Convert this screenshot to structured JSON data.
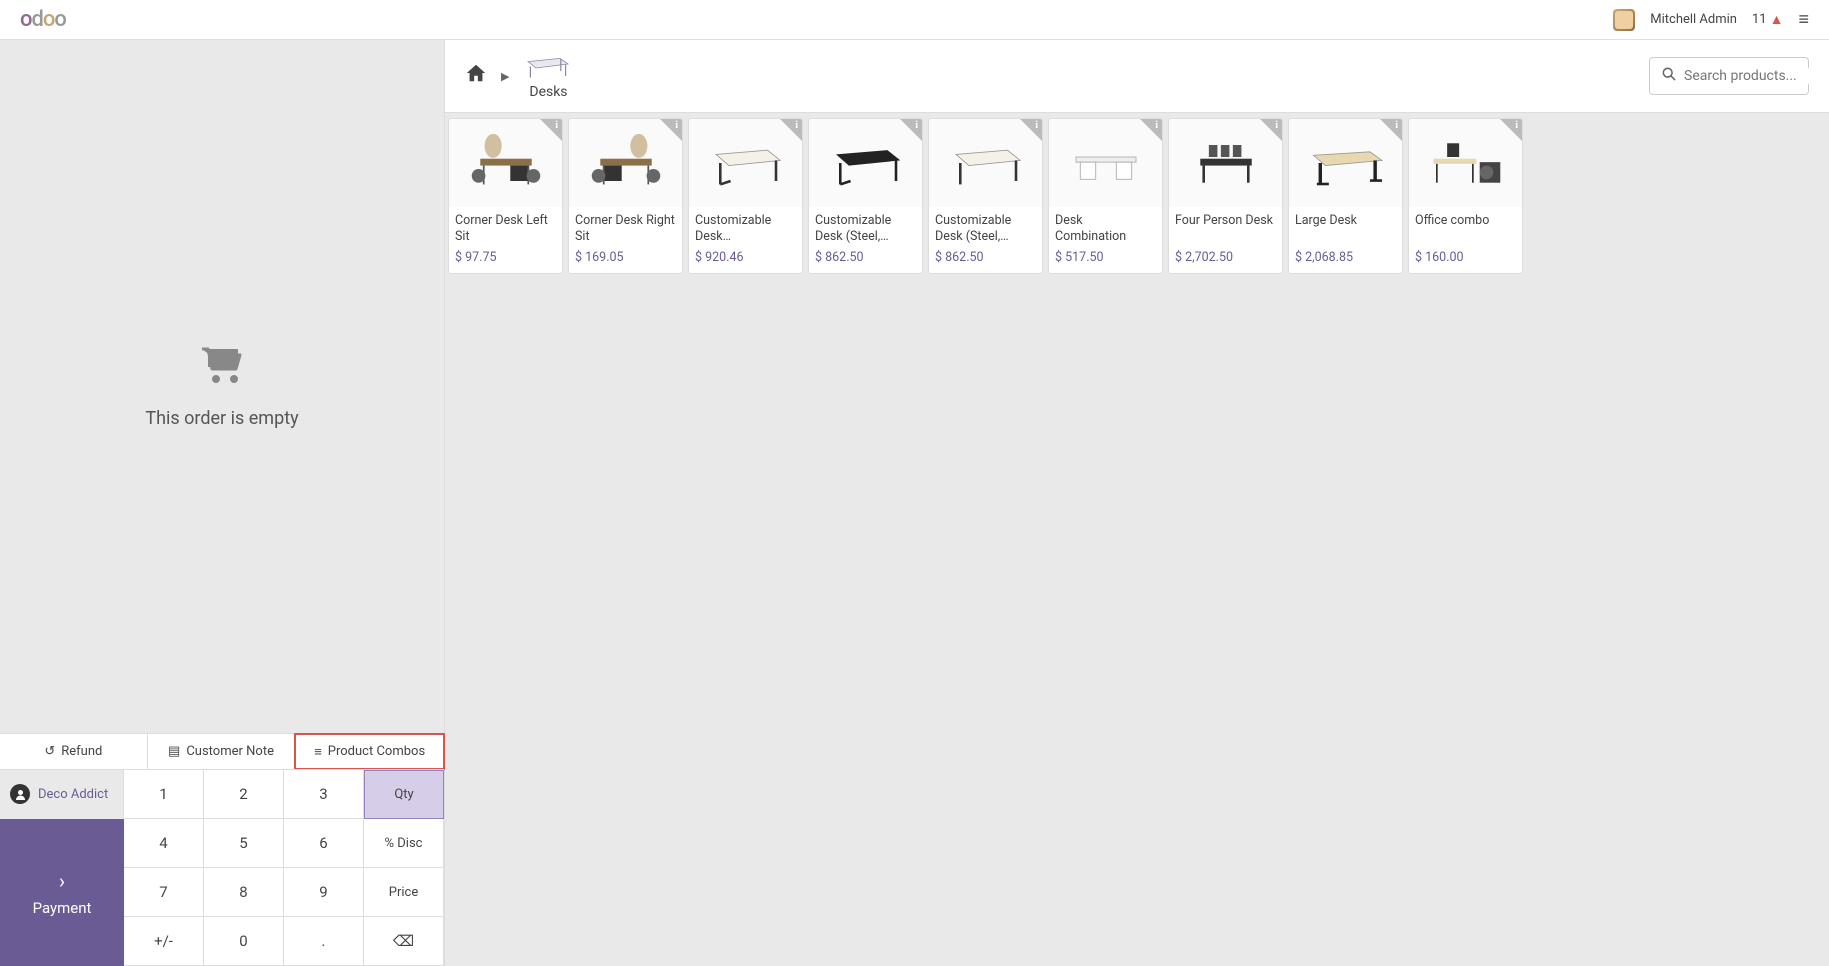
{
  "header": {
    "logo": "odoo",
    "user": "Mitchell Admin",
    "notif_count": "11"
  },
  "cart": {
    "empty_text": "This order is empty"
  },
  "order_actions": {
    "refund": "Refund",
    "customer_note": "Customer Note",
    "product_combos": "Product Combos"
  },
  "customer": {
    "name": "Deco Addict"
  },
  "numpad": {
    "k1": "1",
    "k2": "2",
    "k3": "3",
    "qty": "Qty",
    "k4": "4",
    "k5": "5",
    "k6": "6",
    "disc": "% Disc",
    "k7": "7",
    "k8": "8",
    "k9": "9",
    "price": "Price",
    "pm": "+/-",
    "k0": "0",
    "dot": ".",
    "back": "⌫"
  },
  "payment_label": "Payment",
  "breadcrumb": {
    "category": "Desks"
  },
  "search": {
    "placeholder": "Search products..."
  },
  "products": [
    {
      "name": "Corner Desk Left Sit",
      "price": "$ 97.75",
      "img": "corner-left"
    },
    {
      "name": "Corner Desk Right Sit",
      "price": "$ 169.05",
      "img": "corner-right"
    },
    {
      "name": "Customizable Desk…",
      "price": "$ 920.46",
      "img": "desk-white"
    },
    {
      "name": "Customizable Desk (Steel,…",
      "price": "$ 862.50",
      "img": "desk-black"
    },
    {
      "name": "Customizable Desk (Steel,…",
      "price": "$ 862.50",
      "img": "desk-white2"
    },
    {
      "name": "Desk Combination",
      "price": "$ 517.50",
      "img": "desk-combo"
    },
    {
      "name": "Four Person Desk",
      "price": "$ 2,702.50",
      "img": "four-person"
    },
    {
      "name": "Large Desk",
      "price": "$ 2,068.85",
      "img": "large-desk"
    },
    {
      "name": "Office combo",
      "price": "$ 160.00",
      "img": "office-combo"
    }
  ]
}
